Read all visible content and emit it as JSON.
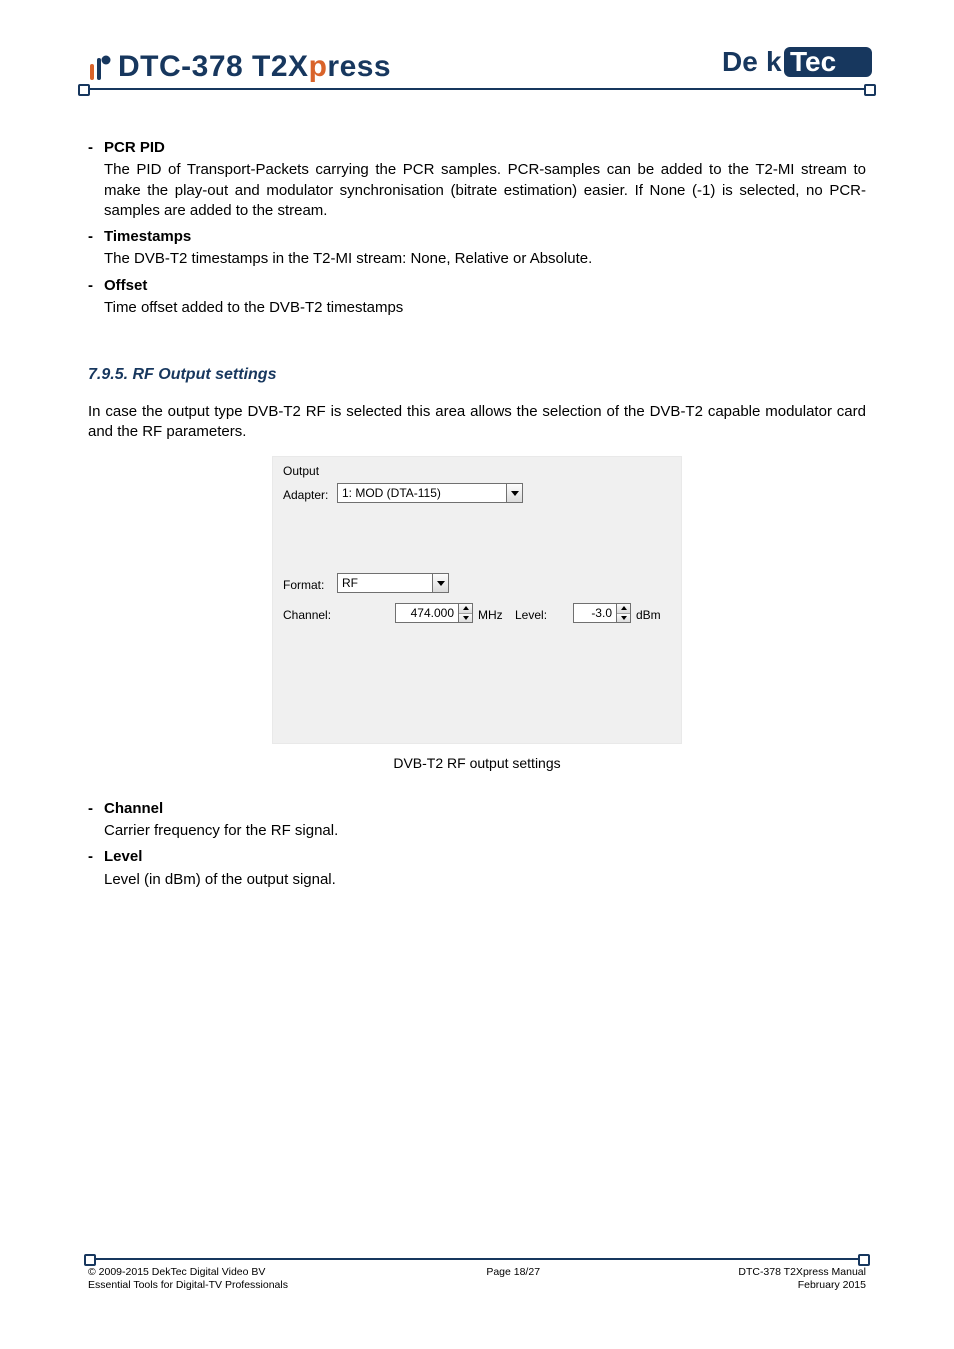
{
  "header": {
    "title_prefix": "DTC-378 T2X",
    "title_accent": "p",
    "title_suffix": "ress",
    "brand": "DekTec"
  },
  "items_top": [
    {
      "term": "PCR PID",
      "desc": "The PID of Transport-Packets carrying the PCR samples. PCR-samples can be added to the T2-MI stream to make the play-out and modulator synchronisation (bitrate estimation) easier.  If None (-1) is selected, no PCR-samples are added to the stream."
    },
    {
      "term": "Timestamps",
      "desc": "The DVB-T2 timestamps in the T2-MI stream: None, Relative or Absolute."
    },
    {
      "term": "Offset",
      "desc": "Time offset added to the DVB-T2 timestamps"
    }
  ],
  "section": {
    "heading": "7.9.5. RF Output settings",
    "intro": "In case the output type DVB-T2 RF is selected this area allows the selection of the DVB-T2 capable modulator card and the RF parameters."
  },
  "shot": {
    "group": "Output",
    "adapter_lbl": "Adapter:",
    "adapter_val": "1: MOD (DTA-115)",
    "format_lbl": "Format:",
    "format_val": "RF",
    "channel_lbl": "Channel:",
    "channel_val": "474.000",
    "channel_unit": "MHz",
    "level_lbl": "Level:",
    "level_val": "-3.0",
    "level_unit": "dBm"
  },
  "caption": "DVB-T2 RF output settings",
  "items_bottom": [
    {
      "term": "Channel",
      "desc": "Carrier frequency for the RF signal."
    },
    {
      "term": "Level",
      "desc": "Level (in dBm) of the output signal."
    }
  ],
  "footer": {
    "left1": "© 2009-2015 DekTec Digital Video BV",
    "left2": "Essential Tools for Digital-TV Professionals",
    "center": "Page 18/27",
    "right1": "DTC-378 T2Xpress Manual",
    "right2": "February 2015"
  }
}
